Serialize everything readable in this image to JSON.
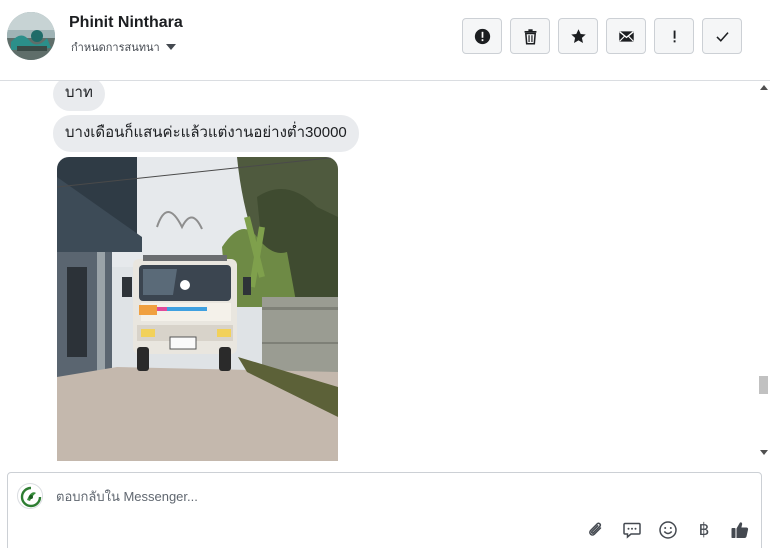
{
  "contact": {
    "name": "Phinit Ninthara",
    "assign_label": "กำหนดการสนทนา"
  },
  "header_actions": [
    {
      "icon": "alert-circle-icon"
    },
    {
      "icon": "trash-icon"
    },
    {
      "icon": "star-icon"
    },
    {
      "icon": "envelope-icon"
    },
    {
      "icon": "exclamation-icon"
    },
    {
      "icon": "checkmark-icon"
    }
  ],
  "messages": [
    {
      "type": "text",
      "text": "บาท"
    },
    {
      "type": "text",
      "text": "บางเดือนก็แสนค่ะแล้วแต่งานอย่างต่ำ30000"
    },
    {
      "type": "photo",
      "icon": "truck-photo"
    }
  ],
  "composer": {
    "placeholder": "ตอบกลับใน Messenger...",
    "tools": [
      "paperclip-icon",
      "speech-bubble-icon",
      "smiley-icon",
      "baht-icon",
      "thumbs-up-icon"
    ],
    "baht_glyph": "฿"
  },
  "colors": {
    "bubble": "#e9ebee",
    "border": "#dadde1",
    "like": "#444950"
  }
}
